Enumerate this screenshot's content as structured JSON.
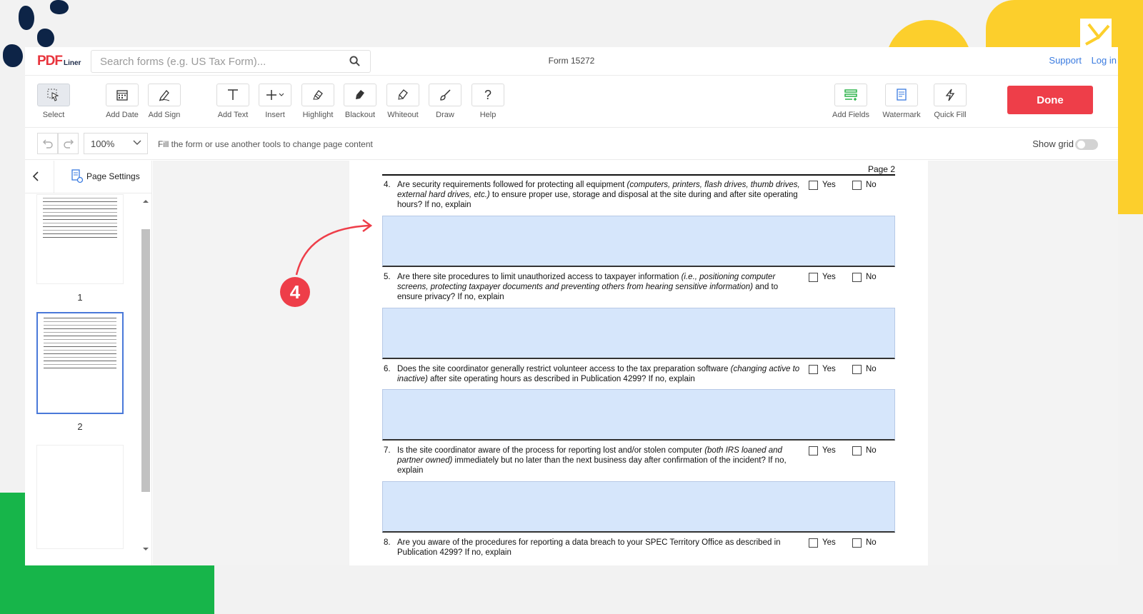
{
  "logo": {
    "brand": "PDF",
    "sub": "Liner"
  },
  "search": {
    "placeholder": "Search forms (e.g. US Tax Form)..."
  },
  "document_title": "Form 15272",
  "top_links": {
    "support": "Support",
    "login": "Log in"
  },
  "toolbar": {
    "tools": [
      {
        "label": "Select",
        "icon": "select-cursor-icon"
      },
      {
        "label": "Add Date",
        "icon": "calendar-icon"
      },
      {
        "label": "Add Sign",
        "icon": "signature-icon"
      },
      {
        "label": "Add Text",
        "icon": "text-t-icon"
      },
      {
        "label": "Insert",
        "icon": "plus-icon"
      },
      {
        "label": "Highlight",
        "icon": "highlighter-icon"
      },
      {
        "label": "Blackout",
        "icon": "blackout-icon"
      },
      {
        "label": "Whiteout",
        "icon": "whiteout-icon"
      },
      {
        "label": "Draw",
        "icon": "brush-icon"
      },
      {
        "label": "Help",
        "icon": "question-icon"
      },
      {
        "label": "Add Fields",
        "icon": "add-fields-icon"
      },
      {
        "label": "Watermark",
        "icon": "watermark-icon"
      },
      {
        "label": "Quick Fill",
        "icon": "lightning-icon"
      }
    ],
    "done_label": "Done"
  },
  "options": {
    "zoom": "100%",
    "hint": "Fill the form or use another tools to change page content",
    "show_grid": "Show grid"
  },
  "sidebar": {
    "page_settings": "Page Settings",
    "thumbnails": [
      {
        "label": "1"
      },
      {
        "label": "2"
      }
    ]
  },
  "page": {
    "label": "Page 2",
    "questions": [
      {
        "num": "4.",
        "text_plain": "Are security requirements followed for protecting all equipment ",
        "text_italic": "(computers, printers, flash drives, thumb drives, external hard drives, etc.)",
        "text_tail": " to ensure proper use, storage and disposal at the site during and after site operating hours? If no, explain",
        "yes": "Yes",
        "no": "No"
      },
      {
        "num": "5.",
        "text_plain": "Are there site procedures to limit unauthorized access to taxpayer information ",
        "text_italic": "(i.e., positioning computer screens, protecting taxpayer documents and preventing others from hearing sensitive information)",
        "text_tail": " and to ensure privacy? If no, explain",
        "yes": "Yes",
        "no": "No"
      },
      {
        "num": "6.",
        "text_plain": "Does the site coordinator generally restrict volunteer access to the tax preparation software ",
        "text_italic": "(changing active to inactive)",
        "text_tail": " after site operating hours as described in Publication 4299? If no, explain",
        "yes": "Yes",
        "no": "No"
      },
      {
        "num": "7.",
        "text_plain": "Is the site coordinator aware of the process for reporting lost and/or stolen computer ",
        "text_italic": "(both IRS loaned and partner owned)",
        "text_tail": " immediately but no later than the next business day after confirmation of the incident? If no, explain",
        "yes": "Yes",
        "no": "No"
      },
      {
        "num": "8.",
        "text_plain": "Are you aware of the procedures for reporting a data breach to your SPEC Territory Office as described in Publication 4299? If no, explain",
        "text_italic": "",
        "text_tail": "",
        "yes": "Yes",
        "no": "No"
      }
    ]
  },
  "annotation": {
    "step": "4"
  },
  "colors": {
    "accent_red": "#ee3e49",
    "link_blue": "#3a7be0",
    "field_blue": "#d6e6fb",
    "deco_yellow": "#fccf2c",
    "deco_green": "#17b54a",
    "deco_navy": "#0d2447"
  }
}
